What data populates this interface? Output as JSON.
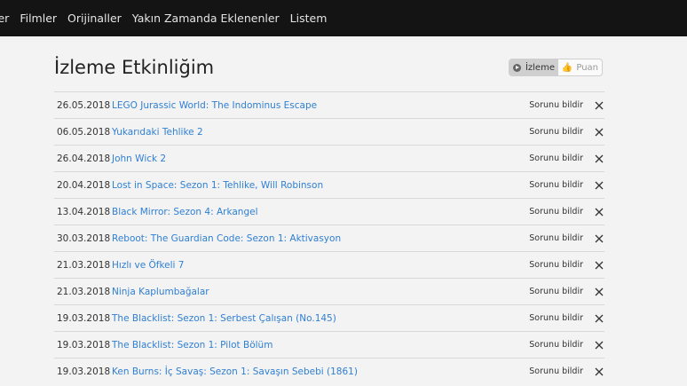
{
  "nav": {
    "items": [
      "ler",
      "Filmler",
      "Orijinaller",
      "Yakın Zamanda Eklenenler",
      "Listem"
    ]
  },
  "page": {
    "title": "İzleme Etkinliğim"
  },
  "toggle": {
    "watch_label": "İzleme",
    "rating_label": "Puan",
    "watch_icon": "play-circle-icon",
    "rating_icon": "thumb-icon"
  },
  "activity": {
    "report_label": "Sorunu bildir",
    "rows": [
      {
        "date": "26.05.2018",
        "title": "LEGO Jurassic World: The Indominus Escape"
      },
      {
        "date": "06.05.2018",
        "title": "Yukarıdaki Tehlike 2"
      },
      {
        "date": "26.04.2018",
        "title": "John Wick 2"
      },
      {
        "date": "20.04.2018",
        "title": "Lost in Space: Sezon 1: Tehlike, Will Robinson"
      },
      {
        "date": "13.04.2018",
        "title": "Black Mirror: Sezon 4: Arkangel"
      },
      {
        "date": "30.03.2018",
        "title": "Reboot: The Guardian Code: Sezon 1: Aktivasyon"
      },
      {
        "date": "21.03.2018",
        "title": "Hızlı ve Öfkeli 7"
      },
      {
        "date": "21.03.2018",
        "title": "Ninja Kaplumbağalar"
      },
      {
        "date": "19.03.2018",
        "title": "The Blacklist: Sezon 1: Serbest Çalışan (No.145)"
      },
      {
        "date": "19.03.2018",
        "title": "The Blacklist: Sezon 1: Pilot Bölüm"
      },
      {
        "date": "19.03.2018",
        "title": "Ken Burns: İç Savaş: Sezon 1: Savaşın Sebebi (1861)"
      }
    ]
  },
  "colors": {
    "link": "#2f7fd3",
    "topbar": "#141414",
    "background": "#f3f3f3"
  }
}
